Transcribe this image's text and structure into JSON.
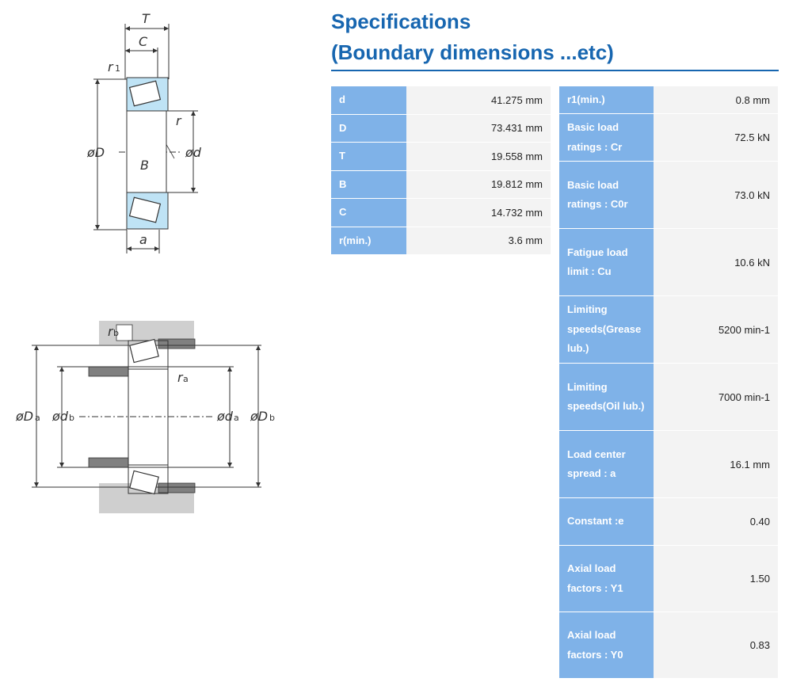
{
  "heading": {
    "line1": "Specifications",
    "line2": "(Boundary dimensions ...etc)"
  },
  "drawing_labels": {
    "T": "T",
    "C": "C",
    "r1": "r",
    "r1_sub": "1",
    "r": "r",
    "D": "øD",
    "d": "ød",
    "B": "B",
    "a": "a",
    "rb": "r",
    "rb_sub": "b",
    "ra": "r",
    "ra_sub": "a",
    "Da": "øD",
    "Da_sub": "a",
    "db": "ød",
    "db_sub": "b",
    "da": "ød",
    "da_sub": "a",
    "Db": "øD",
    "Db_sub": "b"
  },
  "colors": {
    "title": "#1766b0",
    "key_cell": "#7fb2e8",
    "value_cell": "#f3f3f3",
    "bearing_fill": "#bfe3f5"
  },
  "left_table": [
    {
      "key": "d",
      "value": "41.275 mm"
    },
    {
      "key": "D",
      "value": "73.431 mm"
    },
    {
      "key": "T",
      "value": "19.558 mm"
    },
    {
      "key": "B",
      "value": "19.812 mm"
    },
    {
      "key": "C",
      "value": "14.732 mm"
    },
    {
      "key": "r(min.)",
      "value": "3.6 mm"
    }
  ],
  "right_table": [
    {
      "key": "r1(min.)",
      "value": "0.8 mm"
    },
    {
      "key": "Basic load ratings : Cr",
      "value": "72.5 kN"
    },
    {
      "key": "Basic load ratings : C0r",
      "value": "73.0 kN"
    },
    {
      "key": "Fatigue load limit : Cu",
      "value": "10.6 kN"
    },
    {
      "key": "Limiting speeds(Grease lub.)",
      "value": "5200 min-1"
    },
    {
      "key": "Limiting speeds(Oil lub.)",
      "value": "7000 min-1"
    },
    {
      "key": "Load center spread : a",
      "value": "16.1 mm"
    },
    {
      "key": "Constant :e",
      "value": "0.40"
    },
    {
      "key": "Axial load factors : Y1",
      "value": "1.50"
    },
    {
      "key": "Axial load factors : Y0",
      "value": "0.83"
    }
  ]
}
